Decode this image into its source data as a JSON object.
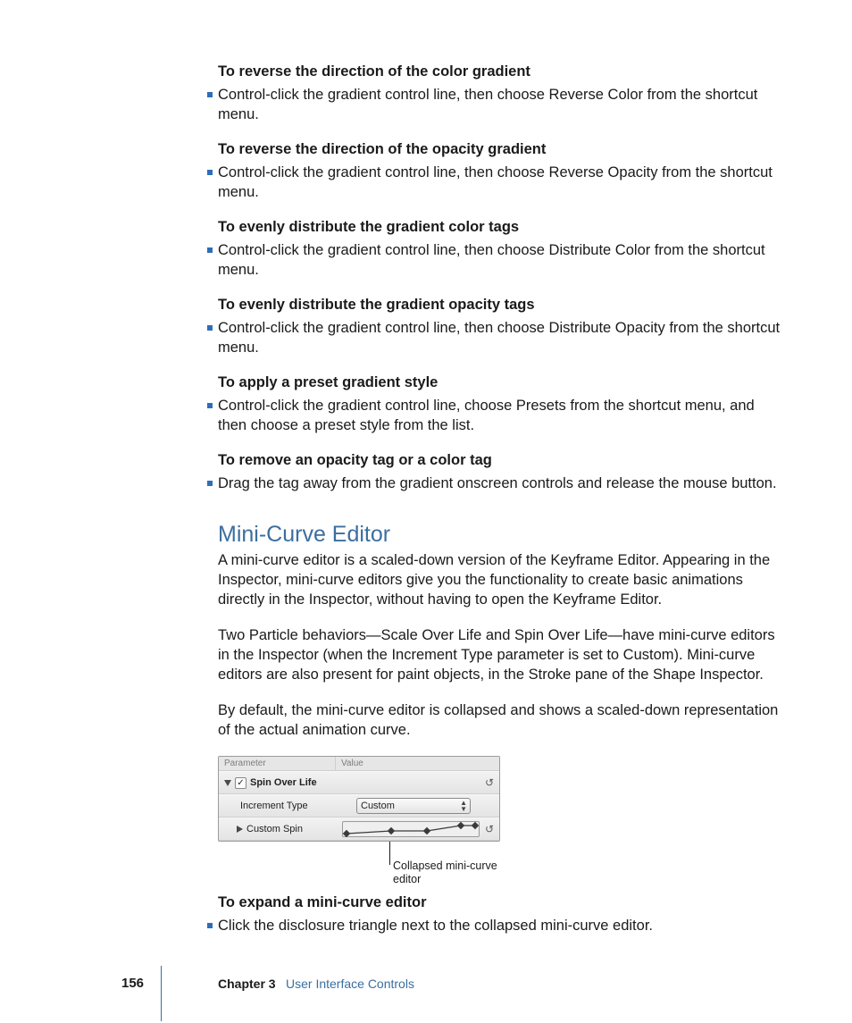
{
  "sections": [
    {
      "heading": "To reverse the direction of the color gradient",
      "bullet": "Control-click the gradient control line, then choose Reverse Color from the shortcut menu."
    },
    {
      "heading": "To reverse the direction of the opacity gradient",
      "bullet": "Control-click the gradient control line, then choose Reverse Opacity from the shortcut menu."
    },
    {
      "heading": "To evenly distribute the gradient color tags",
      "bullet": "Control-click the gradient control line, then choose Distribute Color from the shortcut menu."
    },
    {
      "heading": "To evenly distribute the gradient opacity tags",
      "bullet": "Control-click the gradient control line, then choose Distribute Opacity from the shortcut menu."
    },
    {
      "heading": "To apply a preset gradient style",
      "bullet": "Control-click the gradient control line, choose Presets from the shortcut menu, and then choose a preset style from the list."
    },
    {
      "heading": "To remove an opacity tag or a color tag",
      "bullet": "Drag the tag away from the gradient onscreen controls and release the mouse button."
    }
  ],
  "mini": {
    "title": "Mini-Curve Editor",
    "p1": "A mini-curve editor is a scaled-down version of the Keyframe Editor. Appearing in the Inspector, mini-curve editors give you the functionality to create basic animations directly in the Inspector, without having to open the Keyframe Editor.",
    "p2": "Two Particle behaviors—Scale Over Life and Spin Over Life—have mini-curve editors in the Inspector (when the Increment Type parameter is set to Custom). Mini-curve editors are also present for paint objects, in the Stroke pane of the Shape Inspector.",
    "p3": "By default, the mini-curve editor is collapsed and shows a scaled-down representation of the actual animation curve."
  },
  "inspector": {
    "header_param": "Parameter",
    "header_value": "Value",
    "row1_label": "Spin Over Life",
    "row2_label": "Increment Type",
    "row2_value": "Custom",
    "row3_label": "Custom Spin",
    "reset_glyph": "↺",
    "check_glyph": "✓"
  },
  "callout_label": "Collapsed mini-curve editor",
  "expand": {
    "heading": "To expand a mini-curve editor",
    "bullet": "Click the disclosure triangle next to the collapsed mini-curve editor."
  },
  "footer": {
    "page": "156",
    "chapter": "Chapter 3",
    "title": "User Interface Controls"
  }
}
